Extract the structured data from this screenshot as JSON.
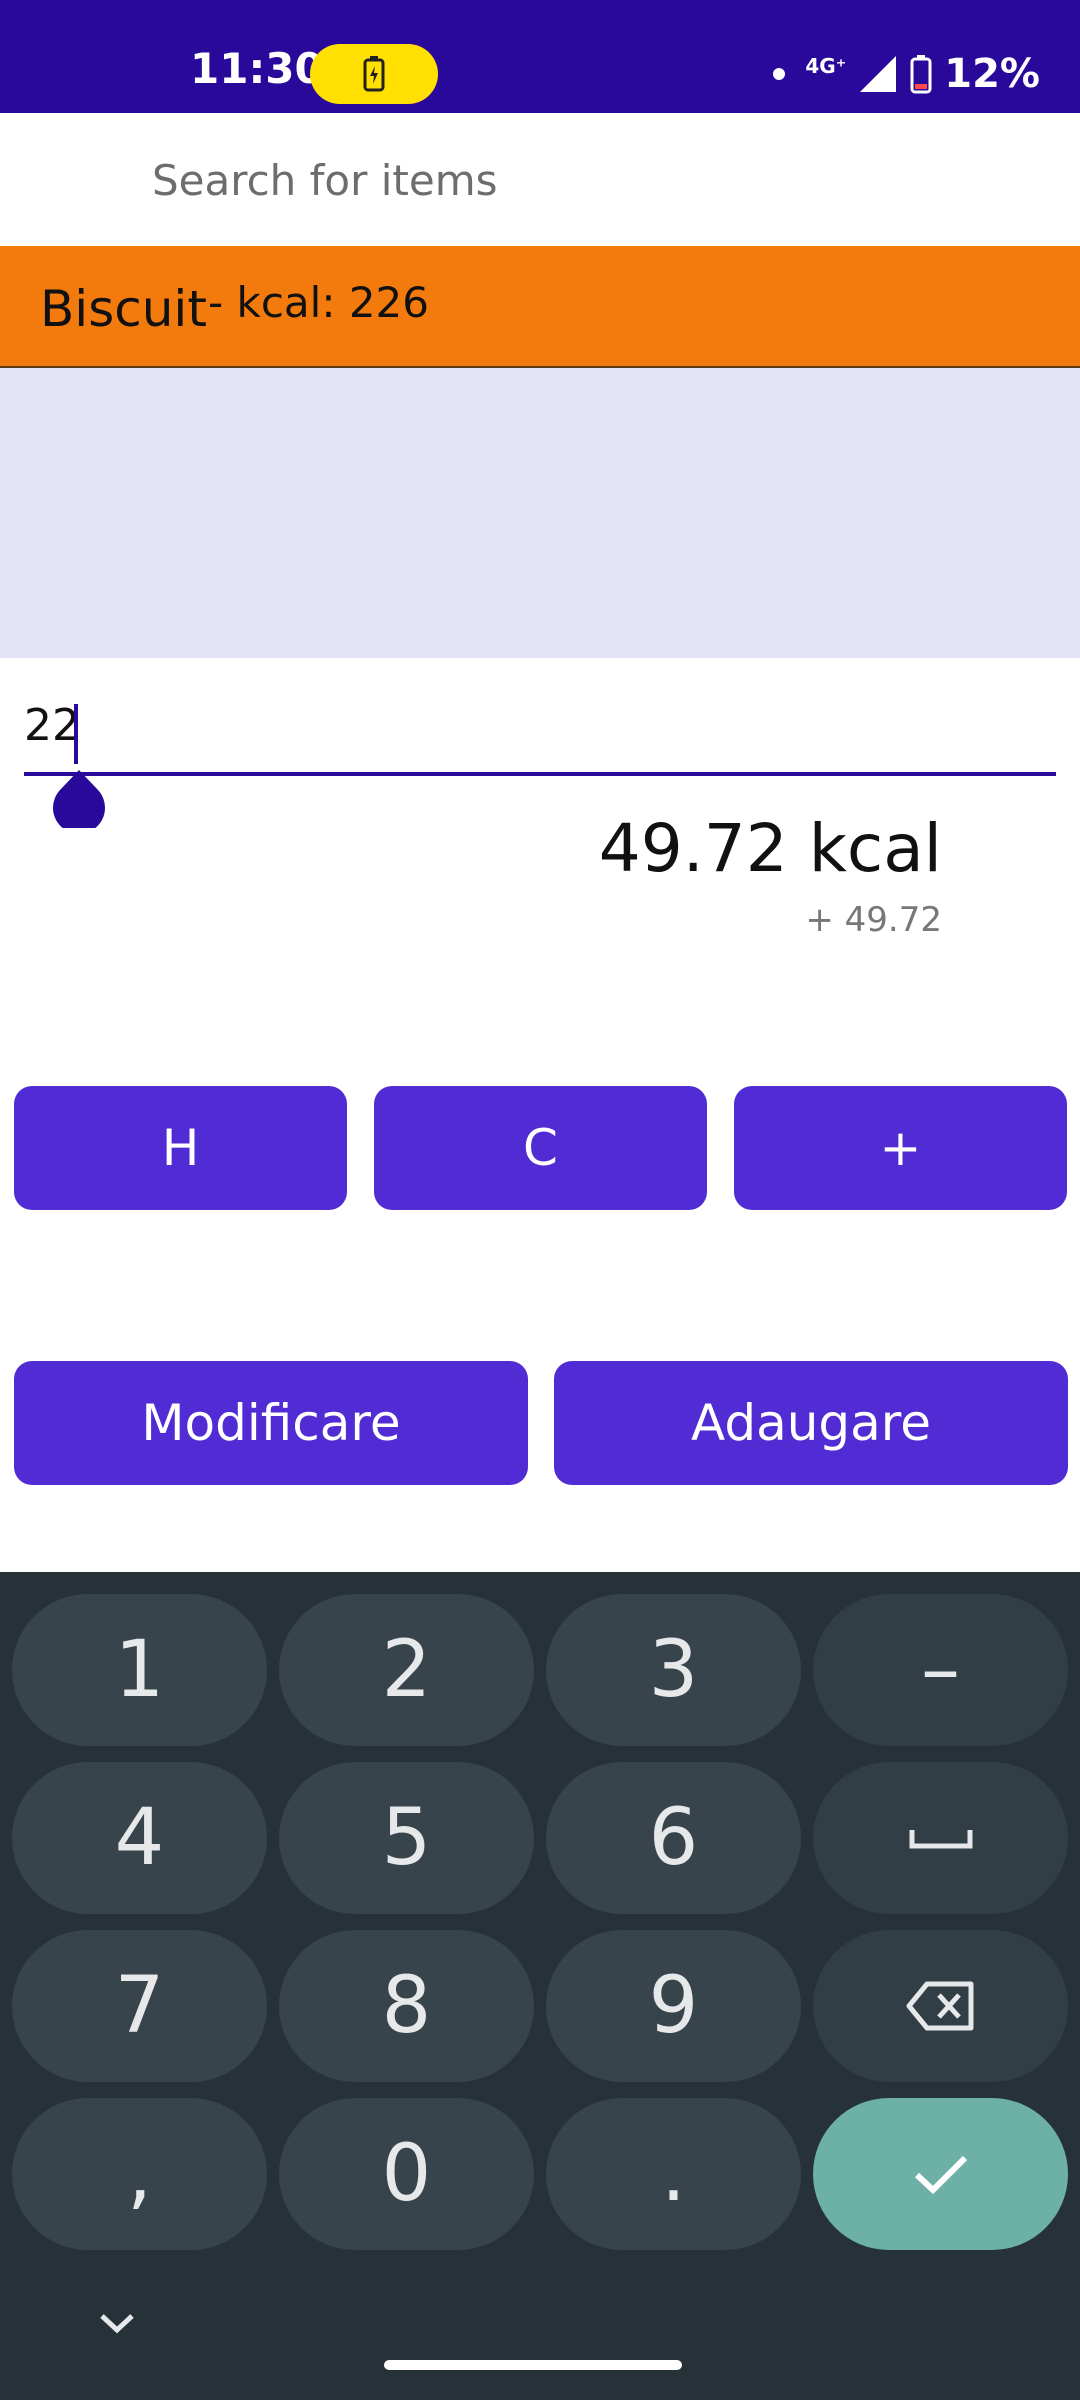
{
  "status_bar": {
    "time": "11:30",
    "network": "4G⁺",
    "battery": "12%"
  },
  "search": {
    "placeholder": "Search for items"
  },
  "selected_item": {
    "name": "Biscuit",
    "detail": "- kcal: 226"
  },
  "amount": {
    "value": "22"
  },
  "result": {
    "total": "49.72 kcal",
    "delta": "+ 49.72"
  },
  "buttons": {
    "h": "H",
    "c": "C",
    "plus": "+",
    "modify": "Modificare",
    "add": "Adaugare"
  },
  "keyboard": {
    "keys": [
      "1",
      "2",
      "3",
      "–",
      "4",
      "5",
      "6",
      "7",
      "8",
      "9",
      ",",
      "0",
      "."
    ],
    "icons": [
      "space-icon",
      "backspace-icon",
      "check-icon",
      "chevron-down-icon"
    ]
  },
  "colors": {
    "status_bar": "#29099a",
    "accent": "#512bd4",
    "item_bar": "#f37a0d",
    "list_bg": "#e3e4f7",
    "keyboard_bg": "#263238",
    "enter_key": "#6db0a6"
  }
}
